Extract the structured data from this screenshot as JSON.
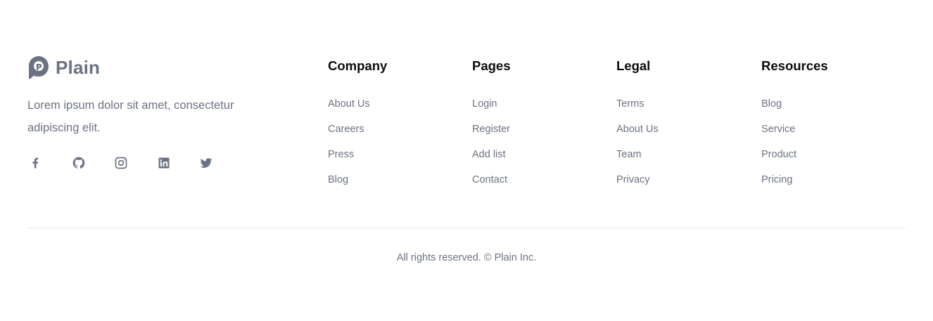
{
  "brand": {
    "name": "Plain",
    "tagline": "Lorem ipsum dolor sit amet, consectetur adipiscing elit."
  },
  "socials": [
    {
      "icon": "facebook-icon"
    },
    {
      "icon": "github-icon"
    },
    {
      "icon": "instagram-icon"
    },
    {
      "icon": "linkedin-icon"
    },
    {
      "icon": "twitter-icon"
    }
  ],
  "columns": [
    {
      "title": "Company",
      "links": [
        "About Us",
        "Careers",
        "Press",
        "Blog"
      ]
    },
    {
      "title": "Pages",
      "links": [
        "Login",
        "Register",
        "Add list",
        "Contact"
      ]
    },
    {
      "title": "Legal",
      "links": [
        "Terms",
        "About Us",
        "Team",
        "Privacy"
      ]
    },
    {
      "title": "Resources",
      "links": [
        "Blog",
        "Service",
        "Product",
        "Pricing"
      ]
    }
  ],
  "copyright": "All rights reserved. © Plain Inc.",
  "colors": {
    "text_muted": "#6b7280",
    "heading": "#0b0b0b",
    "divider": "#e5e7eb"
  }
}
